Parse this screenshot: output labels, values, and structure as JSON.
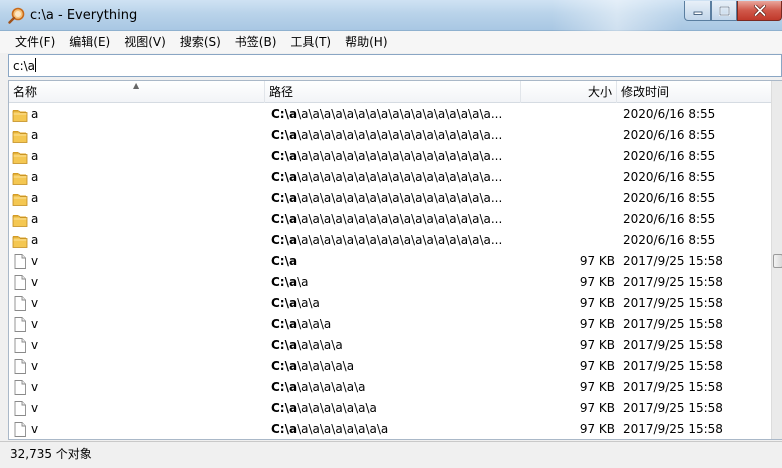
{
  "window": {
    "title": "c:\\a - Everything"
  },
  "menu": [
    {
      "label": "文件(F)"
    },
    {
      "label": "编辑(E)"
    },
    {
      "label": "视图(V)"
    },
    {
      "label": "搜索(S)"
    },
    {
      "label": "书签(B)"
    },
    {
      "label": "工具(T)"
    },
    {
      "label": "帮助(H)"
    }
  ],
  "search": {
    "value": "c:\\a"
  },
  "columns": {
    "name": "名称",
    "path": "路径",
    "size": "大小",
    "date": "修改时间"
  },
  "rows": [
    {
      "icon": "folder-icon",
      "name": "a",
      "path_drive": "C:\\a",
      "path_rest": "\\a\\a\\a\\a\\a\\a\\a\\a\\a\\a\\a\\a\\a\\a\\a\\a\\a...",
      "size": "",
      "date": "2020/6/16 8:55"
    },
    {
      "icon": "folder-icon",
      "name": "a",
      "path_drive": "C:\\a",
      "path_rest": "\\a\\a\\a\\a\\a\\a\\a\\a\\a\\a\\a\\a\\a\\a\\a\\a\\a...",
      "size": "",
      "date": "2020/6/16 8:55"
    },
    {
      "icon": "folder-icon",
      "name": "a",
      "path_drive": "C:\\a",
      "path_rest": "\\a\\a\\a\\a\\a\\a\\a\\a\\a\\a\\a\\a\\a\\a\\a\\a\\a...",
      "size": "",
      "date": "2020/6/16 8:55"
    },
    {
      "icon": "folder-icon",
      "name": "a",
      "path_drive": "C:\\a",
      "path_rest": "\\a\\a\\a\\a\\a\\a\\a\\a\\a\\a\\a\\a\\a\\a\\a\\a\\a...",
      "size": "",
      "date": "2020/6/16 8:55"
    },
    {
      "icon": "folder-icon",
      "name": "a",
      "path_drive": "C:\\a",
      "path_rest": "\\a\\a\\a\\a\\a\\a\\a\\a\\a\\a\\a\\a\\a\\a\\a\\a\\a...",
      "size": "",
      "date": "2020/6/16 8:55"
    },
    {
      "icon": "folder-icon",
      "name": "a",
      "path_drive": "C:\\a",
      "path_rest": "\\a\\a\\a\\a\\a\\a\\a\\a\\a\\a\\a\\a\\a\\a\\a\\a\\a...",
      "size": "",
      "date": "2020/6/16 8:55"
    },
    {
      "icon": "folder-icon",
      "name": "a",
      "path_drive": "C:\\a",
      "path_rest": "\\a\\a\\a\\a\\a\\a\\a\\a\\a\\a\\a\\a\\a\\a\\a\\a\\a...",
      "size": "",
      "date": "2020/6/16 8:55"
    },
    {
      "icon": "file-icon",
      "name": "v",
      "path_drive": "C:\\a",
      "path_rest": "",
      "size": "97 KB",
      "date": "2017/9/25 15:58"
    },
    {
      "icon": "file-icon",
      "name": "v",
      "path_drive": "C:\\a",
      "path_rest": "\\a",
      "size": "97 KB",
      "date": "2017/9/25 15:58"
    },
    {
      "icon": "file-icon",
      "name": "v",
      "path_drive": "C:\\a",
      "path_rest": "\\a\\a",
      "size": "97 KB",
      "date": "2017/9/25 15:58"
    },
    {
      "icon": "file-icon",
      "name": "v",
      "path_drive": "C:\\a",
      "path_rest": "\\a\\a\\a",
      "size": "97 KB",
      "date": "2017/9/25 15:58"
    },
    {
      "icon": "file-icon",
      "name": "v",
      "path_drive": "C:\\a",
      "path_rest": "\\a\\a\\a\\a",
      "size": "97 KB",
      "date": "2017/9/25 15:58"
    },
    {
      "icon": "file-icon",
      "name": "v",
      "path_drive": "C:\\a",
      "path_rest": "\\a\\a\\a\\a\\a",
      "size": "97 KB",
      "date": "2017/9/25 15:58"
    },
    {
      "icon": "file-icon",
      "name": "v",
      "path_drive": "C:\\a",
      "path_rest": "\\a\\a\\a\\a\\a\\a",
      "size": "97 KB",
      "date": "2017/9/25 15:58"
    },
    {
      "icon": "file-icon",
      "name": "v",
      "path_drive": "C:\\a",
      "path_rest": "\\a\\a\\a\\a\\a\\a\\a",
      "size": "97 KB",
      "date": "2017/9/25 15:58"
    },
    {
      "icon": "file-icon",
      "name": "v",
      "path_drive": "C:\\a",
      "path_rest": "\\a\\a\\a\\a\\a\\a\\a\\a",
      "size": "97 KB",
      "date": "2017/9/25 15:58"
    }
  ],
  "status": {
    "text": "32,735 个对象"
  }
}
